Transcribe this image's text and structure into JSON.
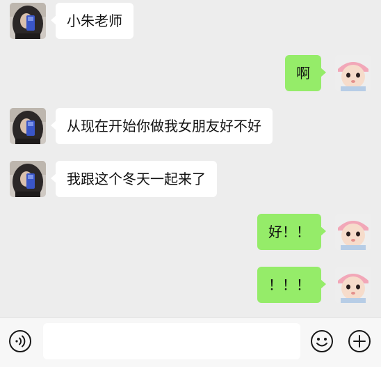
{
  "colors": {
    "background": "#ededed",
    "incoming_bubble": "#ffffff",
    "outgoing_bubble": "#95ec69",
    "text": "#111111"
  },
  "messages": [
    {
      "side": "incoming",
      "text": "小朱老师"
    },
    {
      "side": "outgoing",
      "text": "啊"
    },
    {
      "side": "incoming",
      "text": "从现在开始你做我女朋友好不好"
    },
    {
      "side": "incoming",
      "text": "我跟这个冬天一起来了"
    },
    {
      "side": "outgoing",
      "text": "好！！"
    },
    {
      "side": "outgoing",
      "text": "！！！"
    }
  ],
  "input_bar": {
    "value": "",
    "voice_icon": "voice-icon",
    "emoji_icon": "emoji-icon",
    "plus_icon": "plus-icon"
  }
}
